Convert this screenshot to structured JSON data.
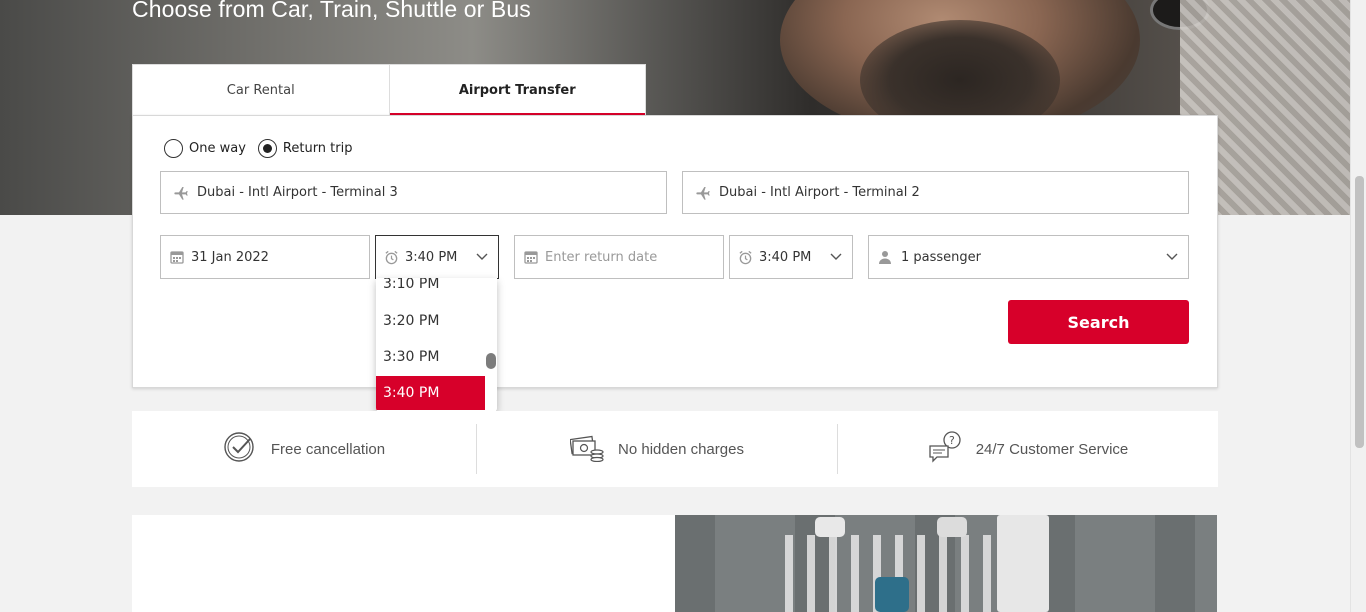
{
  "hero": {
    "title": "Choose from Car, Train, Shuttle or Bus"
  },
  "tabs": [
    {
      "label": "Car Rental",
      "active": false
    },
    {
      "label": "Airport Transfer",
      "active": true
    }
  ],
  "trip_type": {
    "options": [
      {
        "label": "One way",
        "checked": false
      },
      {
        "label": "Return trip",
        "checked": true
      }
    ]
  },
  "locations": {
    "from": "Dubai - Intl Airport - Terminal 3",
    "to": "Dubai - Intl Airport - Terminal 2"
  },
  "pickup": {
    "date": "31 Jan 2022",
    "time": "3:40 PM"
  },
  "return": {
    "date_placeholder": "Enter return date",
    "time": "3:40 PM"
  },
  "passengers": "1 passenger",
  "time_dropdown": {
    "options": [
      "3:10 PM",
      "3:20 PM",
      "3:30 PM",
      "3:40 PM"
    ],
    "selected": "3:40 PM"
  },
  "search_label": "Search",
  "features": [
    {
      "icon": "check-circle-icon",
      "label": "Free cancellation"
    },
    {
      "icon": "money-icon",
      "label": "No hidden charges"
    },
    {
      "icon": "support-chat-icon",
      "label": "24/7 Customer Service"
    }
  ],
  "colors": {
    "accent": "#d7002a",
    "border": "#bfbfbf",
    "background": "#f2f2f2"
  }
}
